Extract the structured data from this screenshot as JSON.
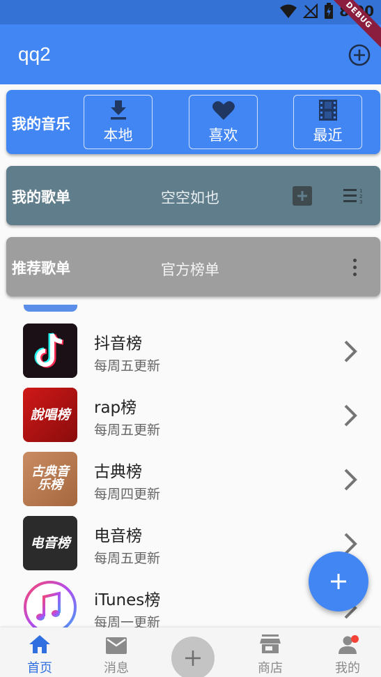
{
  "status_bar": {
    "time": "8:00",
    "debug_label": "DEBUG"
  },
  "app_bar": {
    "title": "qq2"
  },
  "my_music": {
    "label": "我的音乐",
    "buttons": [
      {
        "label": "本地",
        "icon": "download-icon"
      },
      {
        "label": "喜欢",
        "icon": "heart-icon"
      },
      {
        "label": "最近",
        "icon": "film-icon"
      }
    ]
  },
  "my_playlist": {
    "label": "我的歌单",
    "status": "空空如也"
  },
  "recommend": {
    "label": "推荐歌单",
    "subtitle": "官方榜单"
  },
  "rankings": [
    {
      "title": "抖音榜",
      "subtitle": "每周五更新",
      "thumb_text": "",
      "thumb_icon": "tiktok-logo"
    },
    {
      "title": "rap榜",
      "subtitle": "每周五更新",
      "thumb_text": "說唱榜"
    },
    {
      "title": "古典榜",
      "subtitle": "每周四更新",
      "thumb_text": "古典音乐榜"
    },
    {
      "title": "电音榜",
      "subtitle": "每周五更新",
      "thumb_text": "电音榜"
    },
    {
      "title": "iTunes榜",
      "subtitle": "每周一更新",
      "thumb_icon": "itunes-logo"
    }
  ],
  "bottom_nav": [
    {
      "label": "首页",
      "icon": "home-icon",
      "active": true
    },
    {
      "label": "消息",
      "icon": "mail-icon",
      "active": false
    },
    {
      "label": "商店",
      "icon": "store-icon",
      "active": false
    },
    {
      "label": "我的",
      "icon": "person-icon",
      "active": false
    }
  ],
  "colors": {
    "primary": "#4286f4",
    "status_bar": "#3572d6",
    "playlist_card": "#607d8b",
    "recommend_card": "#9e9e9e",
    "nav_active": "#2f6fe0"
  }
}
